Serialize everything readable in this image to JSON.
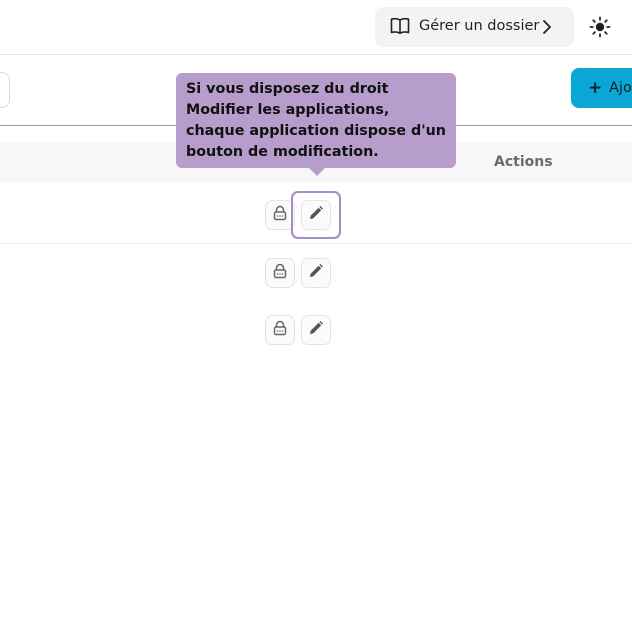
{
  "header": {
    "manage_folder_label": "Gérer un dossier",
    "book_icon": "book-icon",
    "chevron_icon": "chevron-right-icon",
    "theme_icon": "sun-icon"
  },
  "toolbar": {
    "add_label": "Ajo",
    "add_icon": "+",
    "add_color": "#0aa7d6"
  },
  "table": {
    "actions_header": "Actions",
    "rows": [
      {
        "lock_icon": "lock-icon",
        "edit_icon": "edit-pencil-icon"
      },
      {
        "lock_icon": "lock-icon",
        "edit_icon": "edit-pencil-icon"
      },
      {
        "lock_icon": "lock-icon",
        "edit_icon": "edit-pencil-icon"
      }
    ]
  },
  "tooltip": {
    "text": "Si vous disposez du droit Modifier les applications, chaque application dispose d'un bouton de modification.",
    "color": "#b69dcc"
  }
}
